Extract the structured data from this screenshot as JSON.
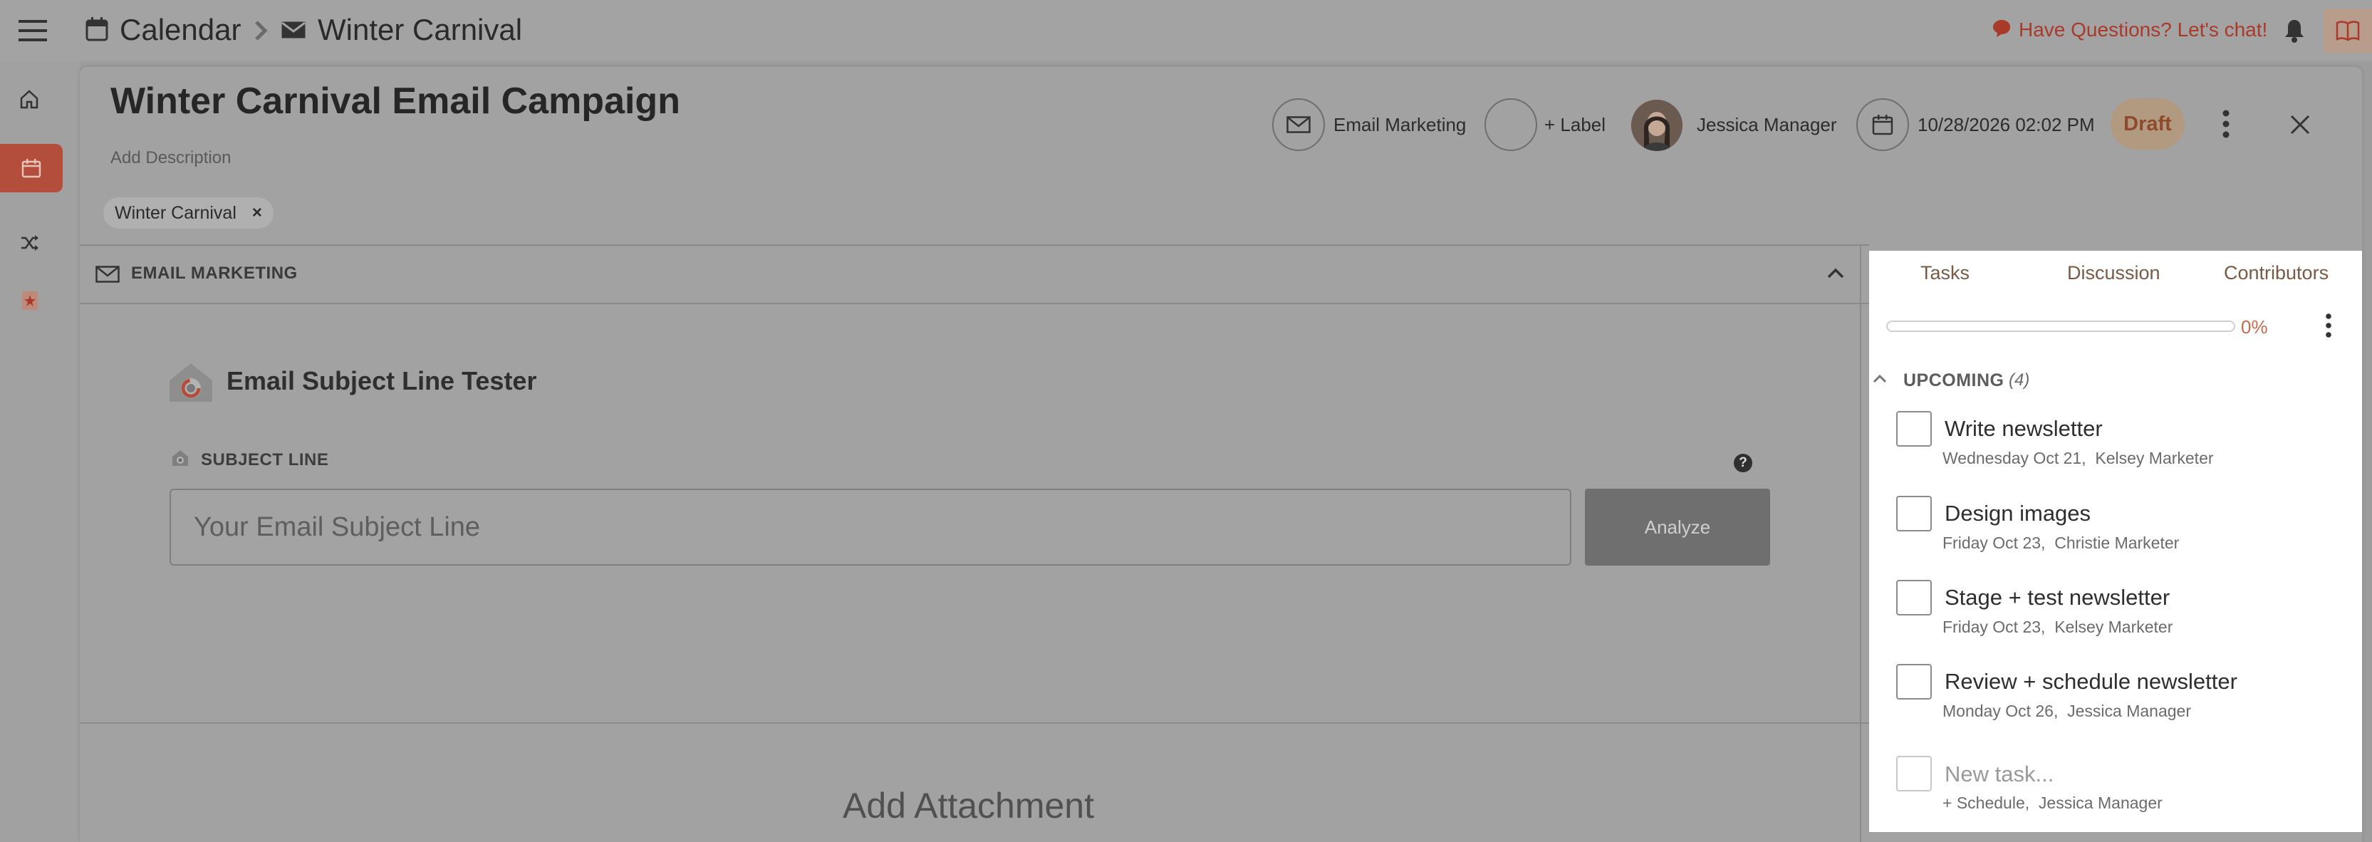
{
  "breadcrumb": {
    "root": "Calendar",
    "current": "Winter Carnival"
  },
  "header": {
    "chat_link": "Have Questions? Let's chat!"
  },
  "campaign": {
    "title": "Winter Carnival Email Campaign",
    "description_placeholder": "Add Description",
    "tag": "Winter Carnival",
    "tag_remove": "×",
    "channel": "Email Marketing",
    "label_button": "+ Label",
    "owner": "Jessica Manager",
    "datetime": "10/28/2026 02:02 PM",
    "status": "Draft"
  },
  "section": {
    "label": "EMAIL MARKETING"
  },
  "tester": {
    "title": "Email Subject Line Tester",
    "field_label": "SUBJECT LINE",
    "placeholder": "Your Email Subject Line",
    "analyze_label": "Analyze",
    "help": "?"
  },
  "attachment": {
    "label": "Add Attachment"
  },
  "panel": {
    "tabs": [
      "Tasks",
      "Discussion",
      "Contributors"
    ],
    "progress": 0,
    "progress_text": "0%",
    "group_label": "UPCOMING",
    "group_count": "(4)",
    "tasks": [
      {
        "title": "Write newsletter",
        "date": "Wednesday Oct 21,",
        "assignee": "Kelsey Marketer"
      },
      {
        "title": "Design images",
        "date": "Friday Oct 23,",
        "assignee": "Christie Marketer"
      },
      {
        "title": "Stage + test newsletter",
        "date": "Friday Oct 23,",
        "assignee": "Kelsey Marketer"
      },
      {
        "title": "Review + schedule newsletter",
        "date": "Monday Oct 26,",
        "assignee": "Jessica Manager"
      }
    ],
    "new_task": {
      "placeholder": "New task...",
      "schedule": "+ Schedule,",
      "assignee": "Jessica Manager"
    }
  },
  "colors": {
    "accent": "#b24e3b",
    "panel_accent": "#c86a4c",
    "overlay": "#9c9c9c"
  },
  "icons": [
    "menu-icon",
    "calendar-icon",
    "chevron-right-icon",
    "envelope-icon",
    "chat-bubble-icon",
    "bell-icon",
    "book-icon",
    "home-icon",
    "shuffle-icon",
    "star-icon",
    "more-vertical-icon",
    "close-icon",
    "chevron-up-icon"
  ]
}
